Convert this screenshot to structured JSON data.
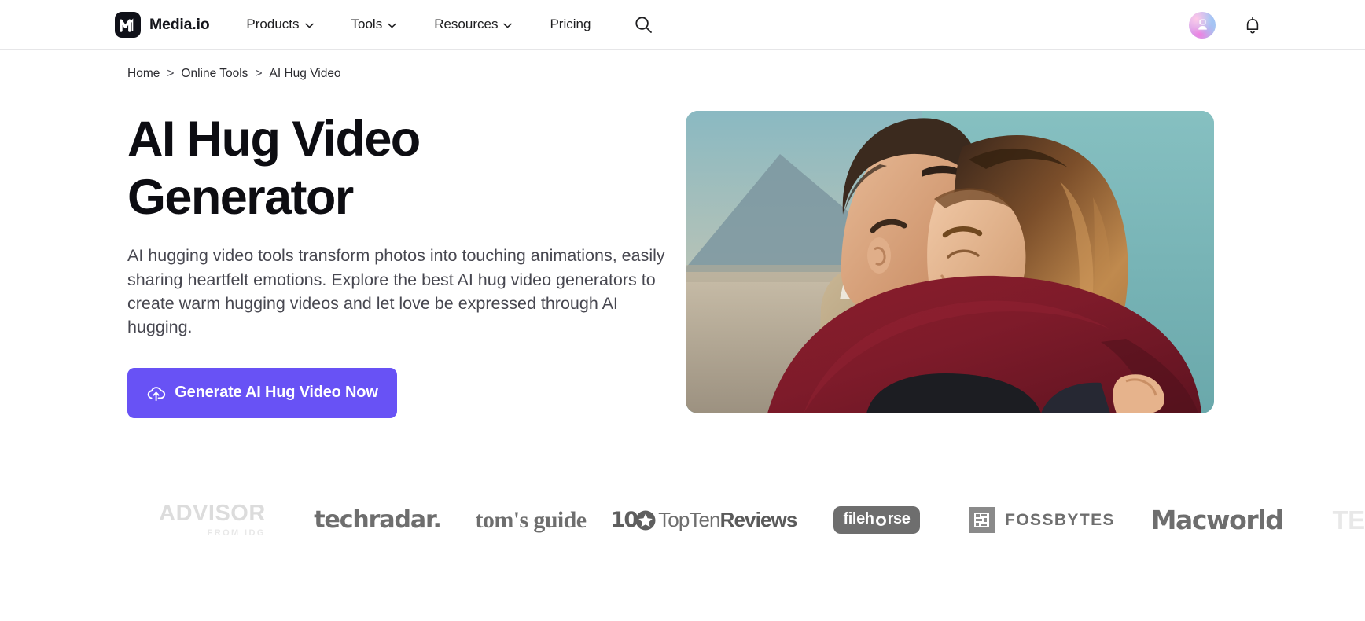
{
  "header": {
    "brand_name": "Media.io",
    "brand_mark_icon": "media-io-logo-icon",
    "nav": [
      {
        "label": "Products",
        "has_dropdown": true
      },
      {
        "label": "Tools",
        "has_dropdown": true
      },
      {
        "label": "Resources",
        "has_dropdown": true
      },
      {
        "label": "Pricing",
        "has_dropdown": false
      }
    ],
    "search_icon": "search-icon",
    "avatar_icon": "user-avatar-icon",
    "notification_icon": "bell-icon"
  },
  "breadcrumb": {
    "items": [
      "Home",
      "Online Tools",
      "AI Hug Video"
    ],
    "separator": ">"
  },
  "hero": {
    "title": "AI Hug Video Generator",
    "description": "AI hugging video tools transform photos into touching animations, easily sharing heartfelt emotions. Explore the best AI hug video generators to create warm hugging videos and let love be expressed through AI hugging.",
    "cta_label": "Generate AI Hug Video Now",
    "cta_icon": "cloud-upload-icon",
    "cta_color": "#6852F5",
    "image_alt": "Couple embracing in a warm hug outdoors against a teal backdrop"
  },
  "logos": {
    "items": [
      {
        "name": "advisor-from-idg",
        "primary": "ADVISOR",
        "secondary": "FROM IDG",
        "faded": true
      },
      {
        "name": "techradar",
        "primary": "techradar.",
        "faded": false
      },
      {
        "name": "toms-guide",
        "primary": "tom's guide",
        "faded": false
      },
      {
        "name": "toptenreviews",
        "primary": "10",
        "secondary": "TopTen",
        "tertiary": "Reviews",
        "faded": false
      },
      {
        "name": "filehorse",
        "primary": "fileh",
        "secondary": "rse",
        "faded": false
      },
      {
        "name": "fossbytes",
        "primary": "FOSSBYTES",
        "faded": false
      },
      {
        "name": "macworld",
        "primary": "Macworld",
        "faded": false
      },
      {
        "name": "tech-cut-off",
        "primary": "TE",
        "faded": true
      }
    ]
  },
  "colors": {
    "accent": "#6852F5",
    "text_primary": "#0D0D12",
    "text_secondary": "#474750",
    "border": "#E6E6E8",
    "logo_gray": "#6E6E73"
  }
}
